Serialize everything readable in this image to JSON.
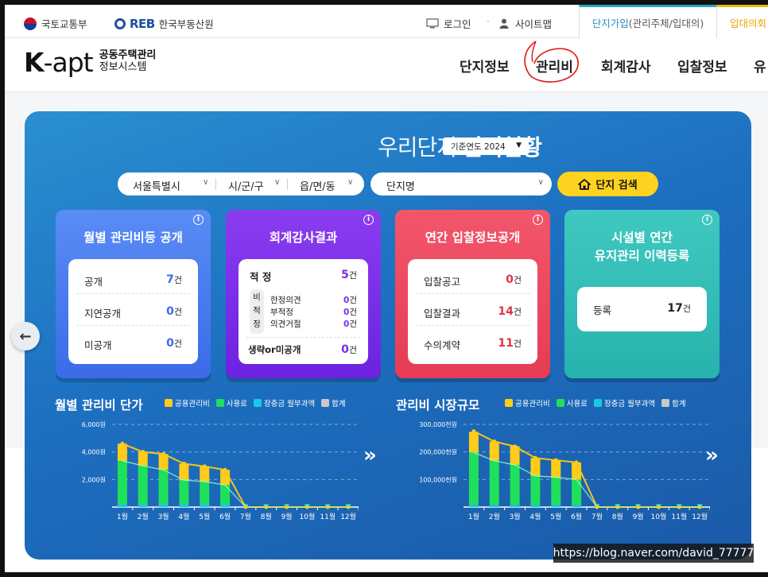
{
  "topbar": {
    "gov_label": "국토교통부",
    "reb_logo": "REB",
    "reb_label": "한국부동산원",
    "login": "로그인",
    "sitemap": "사이트맵",
    "join_tab": "단지가입",
    "join_tab_sub": "(관리주체/입대의)",
    "join_tab2": "입대의회"
  },
  "brand": {
    "main": "K-apt",
    "sub1": "공동주택관리",
    "sub2": "정보시스템"
  },
  "nav": [
    "단지정보",
    "관리비",
    "회계감사",
    "입찰정보",
    "유"
  ],
  "panel": {
    "title_thin": "우리단지",
    "title_bold": "관리현황",
    "year_select": "기준연도 2024",
    "sido": "서울특별시",
    "sigungu": "시/군/구",
    "dong": "읍/면/동",
    "complex": "단지명",
    "search_button": "단지 검색"
  },
  "cards": {
    "c1": {
      "title": "월별 관리비등 공개",
      "rows": [
        {
          "label": "공개",
          "value": "7",
          "unit": "건"
        },
        {
          "label": "지연공개",
          "value": "0",
          "unit": "건"
        },
        {
          "label": "미공개",
          "value": "0",
          "unit": "건"
        }
      ]
    },
    "c2": {
      "title": "회계감사결과",
      "appropriate": {
        "label": "적 정",
        "value": "5",
        "unit": "건"
      },
      "non_label": "비적정",
      "non_rows": [
        {
          "label": "한정의견",
          "value": "0",
          "unit": "건"
        },
        {
          "label": "부적정",
          "value": "0",
          "unit": "건"
        },
        {
          "label": "의견거절",
          "value": "0",
          "unit": "건"
        }
      ],
      "omitted": {
        "label": "생략or미공개",
        "value": "0",
        "unit": "건"
      }
    },
    "c3": {
      "title": "연간 입찰정보공개",
      "rows": [
        {
          "label": "입찰공고",
          "value": "0",
          "unit": "건"
        },
        {
          "label": "입찰결과",
          "value": "14",
          "unit": "건"
        },
        {
          "label": "수의계약",
          "value": "11",
          "unit": "건"
        }
      ]
    },
    "c4": {
      "title1": "시설별 연간",
      "title2": "유지관리 이력등록",
      "row": {
        "label": "등록",
        "value": "17",
        "unit": "건"
      }
    }
  },
  "legend": [
    "공용관리비",
    "사용료",
    "장충금 월부과액",
    "합계"
  ],
  "colors": {
    "common": "#ffcc1a",
    "usage": "#1fe05a",
    "reserve": "#19c9e6",
    "total": "#c9c9c9",
    "line": "#f5c518",
    "panel": "#1d6fc0"
  },
  "chart_data": [
    {
      "type": "bar",
      "title": "월별 관리비 단가",
      "categories": [
        "1월",
        "2월",
        "3월",
        "4월",
        "5월",
        "6월",
        "7월",
        "8월",
        "9월",
        "10월",
        "11월",
        "12월"
      ],
      "ylabel": "",
      "yticks": [
        "2,000원",
        "4,000원",
        "6,000원"
      ],
      "ylim": [
        0,
        6000
      ],
      "stacked": true,
      "series": [
        {
          "name": "공용관리비",
          "values": [
            1250,
            1000,
            1150,
            1200,
            1100,
            1100,
            0,
            0,
            0,
            0,
            0,
            0
          ]
        },
        {
          "name": "사용료",
          "values": [
            3150,
            2800,
            2500,
            1750,
            1650,
            1400,
            0,
            0,
            0,
            0,
            0,
            0
          ]
        },
        {
          "name": "장충금 월부과액",
          "values": [
            200,
            200,
            200,
            200,
            200,
            200,
            0,
            0,
            0,
            0,
            0,
            0
          ]
        },
        {
          "name": "합계",
          "values": [
            4600,
            4000,
            3850,
            3150,
            2950,
            2700,
            0,
            0,
            0,
            0,
            0,
            0
          ]
        }
      ]
    },
    {
      "type": "bar",
      "title": "관리비 시장규모",
      "categories": [
        "1월",
        "2월",
        "3월",
        "4월",
        "5월",
        "6월",
        "7월",
        "8월",
        "9월",
        "10월",
        "11월",
        "12월"
      ],
      "ylabel": "",
      "yticks": [
        "100,000천원",
        "200,000천원",
        "300,000천원"
      ],
      "ylim": [
        0,
        300000
      ],
      "stacked": true,
      "series": [
        {
          "name": "공용관리비",
          "values": [
            75000,
            70000,
            68000,
            65000,
            63000,
            62000,
            0,
            0,
            0,
            0,
            0,
            0
          ]
        },
        {
          "name": "사용료",
          "values": [
            190000,
            160000,
            145000,
            105000,
            100000,
            92000,
            0,
            0,
            0,
            0,
            0,
            0
          ]
        },
        {
          "name": "장충금 월부과액",
          "values": [
            8000,
            8000,
            8000,
            8000,
            8000,
            8000,
            0,
            0,
            0,
            0,
            0,
            0
          ]
        },
        {
          "name": "합계",
          "values": [
            275000,
            238000,
            220000,
            178000,
            170000,
            162000,
            0,
            0,
            0,
            0,
            0,
            0
          ]
        }
      ]
    }
  ],
  "watermark": "https://blog.naver.com/david_77777"
}
